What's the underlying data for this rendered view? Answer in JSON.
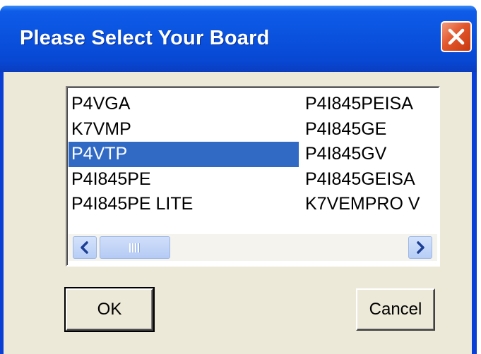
{
  "window": {
    "title": "Please Select Your Board",
    "close_icon": "close-x-icon",
    "title_color": "#0a54e0",
    "face_color": "#ece9d8"
  },
  "board_list": {
    "columns": [
      [
        "P4VGA",
        "K7VMP",
        "P4VTP",
        "P4I845PE",
        "P4I845PE LITE"
      ],
      [
        "P4I845PEISA",
        "P4I845GE",
        "P4I845GV",
        "P4I845GEISA",
        "K7VEMPRO V"
      ]
    ],
    "selected": "P4VTP",
    "selection_color": "#316ac5"
  },
  "scrollbar": {
    "left_icon": "scroll-left-arrow-icon",
    "right_icon": "scroll-right-arrow-icon",
    "thumb_icon": "grip-icon"
  },
  "buttons": {
    "ok_label": "OK",
    "cancel_label": "Cancel"
  }
}
